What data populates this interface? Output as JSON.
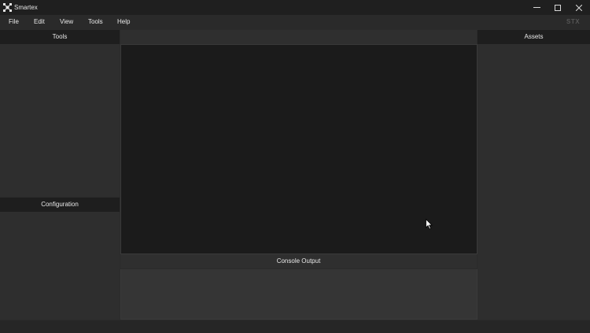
{
  "window": {
    "title": "Smartex",
    "brand_mark": "STX"
  },
  "menu": {
    "items": [
      {
        "label": "File"
      },
      {
        "label": "Edit"
      },
      {
        "label": "View"
      },
      {
        "label": "Tools"
      },
      {
        "label": "Help"
      }
    ]
  },
  "panels": {
    "tools": {
      "title": "Tools"
    },
    "configuration": {
      "title": "Configuration"
    },
    "console": {
      "title": "Console Output"
    },
    "assets": {
      "title": "Assets"
    }
  },
  "icons": {
    "app_logo": "app-logo-icon",
    "minimize": "minimize-icon",
    "maximize": "maximize-icon",
    "close": "close-icon",
    "cursor": "mouse-pointer-icon"
  },
  "colors": {
    "background": "#2b2b2b",
    "panel_header": "#1e1e1e",
    "viewport": "#1b1b1b"
  }
}
